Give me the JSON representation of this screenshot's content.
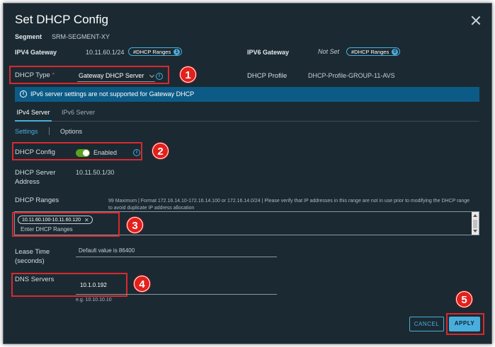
{
  "dialog": {
    "title": "Set DHCP Config"
  },
  "segment": {
    "label": "Segment",
    "value": "SRM-SEGMENT-XY"
  },
  "ipv4_gateway": {
    "label": "IPV4 Gateway",
    "value": "10.11.60.1/24",
    "badge": "#DHCP Ranges",
    "badge_count": "1"
  },
  "ipv6_gateway": {
    "label": "IPV6 Gateway",
    "value": "Not Set",
    "badge": "#DHCP Ranges",
    "badge_count": "0"
  },
  "dhcp_type": {
    "label": "DHCP Type",
    "required_mark": "*",
    "value": "Gateway DHCP Server"
  },
  "dhcp_profile": {
    "label": "DHCP Profile",
    "value": "DHCP-Profile-GROUP-11-AVS"
  },
  "banner": {
    "text": "IPv6 server settings are not supported for Gateway DHCP"
  },
  "tabs": [
    {
      "label": "IPv4 Server"
    },
    {
      "label": "IPv6 Server"
    }
  ],
  "subtabs": [
    {
      "label": "Settings"
    },
    {
      "label": "Options"
    }
  ],
  "dhcp_config": {
    "label": "DHCP Config",
    "state": "Enabled"
  },
  "server_address": {
    "label_line1": "DHCP Server",
    "label_line2": "Address",
    "value": "10.11.50.1/30"
  },
  "dhcp_ranges": {
    "label": "DHCP Ranges",
    "hint": "99 Maximum | Format 172.16.14.10-172.16.14.100 or 172.16.14.0/24 | Please verify that IP addresses in this range are not in use prior to modifying the DHCP range to avoid duplicate IP address allocation",
    "chip": "10.11.60.100-10.11.60.120",
    "placeholder": "Enter DHCP Ranges"
  },
  "lease_time": {
    "label_line1": "Lease Time",
    "label_line2": "(seconds)",
    "placeholder": "Default value is 86400"
  },
  "dns_servers": {
    "label": "DNS Servers",
    "value": "10.1.0.192",
    "example": "e.g. 10.10.10.10"
  },
  "buttons": {
    "cancel": "CANCEL",
    "apply": "APPLY"
  },
  "callouts": [
    "1",
    "2",
    "3",
    "4",
    "5"
  ],
  "colors": {
    "background": "#1b2a32",
    "accent": "#49aedd",
    "banner": "#0c5b87",
    "highlight": "#d9282f",
    "toggle_on": "#5aa220"
  }
}
